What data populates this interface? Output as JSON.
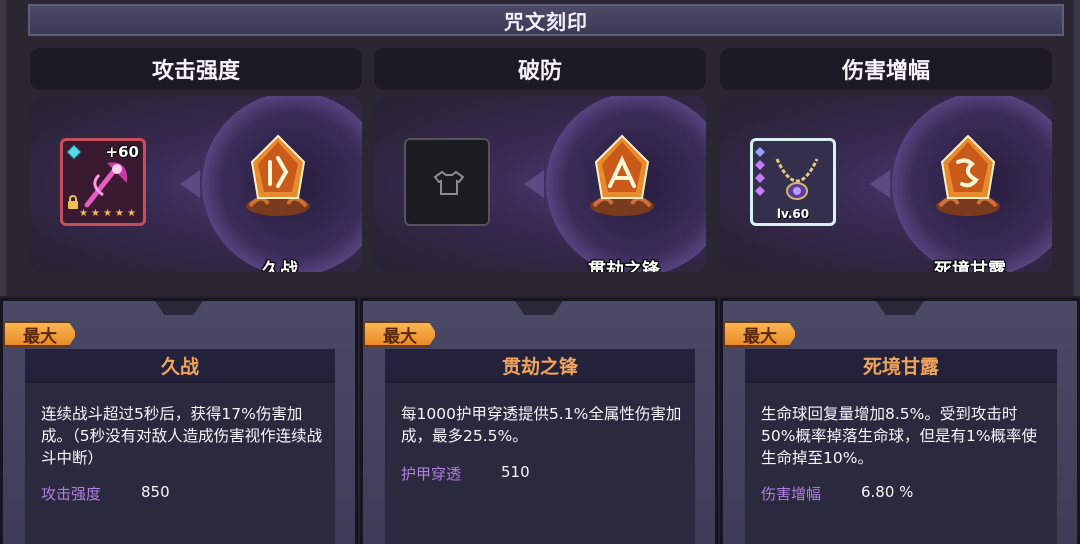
{
  "panel": {
    "title": "咒文刻印"
  },
  "slots": [
    {
      "header": "攻击强度",
      "item": {
        "type": "weapon",
        "level_tag": "+60",
        "stars": 5
      },
      "rune_name": "久战",
      "colors": {
        "border": "#c64d5c"
      }
    },
    {
      "header": "破防",
      "item": {
        "type": "empty"
      },
      "rune_name": "贯劫之锋"
    },
    {
      "header": "伤害增幅",
      "item": {
        "type": "amulet",
        "level_label": "lv.60"
      },
      "rune_name": "死境甘露"
    }
  ],
  "cards": [
    {
      "badge": "最大",
      "title": "久战",
      "description": "连续战斗超过5秒后，获得17%伤害加成。（5秒没有对敌人造成伤害视作连续战斗中断）",
      "stat_name": "攻击强度",
      "stat_value": "850"
    },
    {
      "badge": "最大",
      "title": "贯劫之锋",
      "description": "每1000护甲穿透提供5.1%全属性伤害加成，最多25.5%。",
      "stat_name": "护甲穿透",
      "stat_value": "510"
    },
    {
      "badge": "最大",
      "title": "死境甘露",
      "description": "生命球回复量增加8.5%。受到攻击时50%概率掉落生命球，但是有1%概率使生命掉至10%。",
      "stat_name": "伤害增幅",
      "stat_value": "6.80 %"
    }
  ],
  "colors": {
    "accent_orange": "#f0a45a",
    "stat_purple": "#b07ee0",
    "badge": "#fbb650"
  }
}
